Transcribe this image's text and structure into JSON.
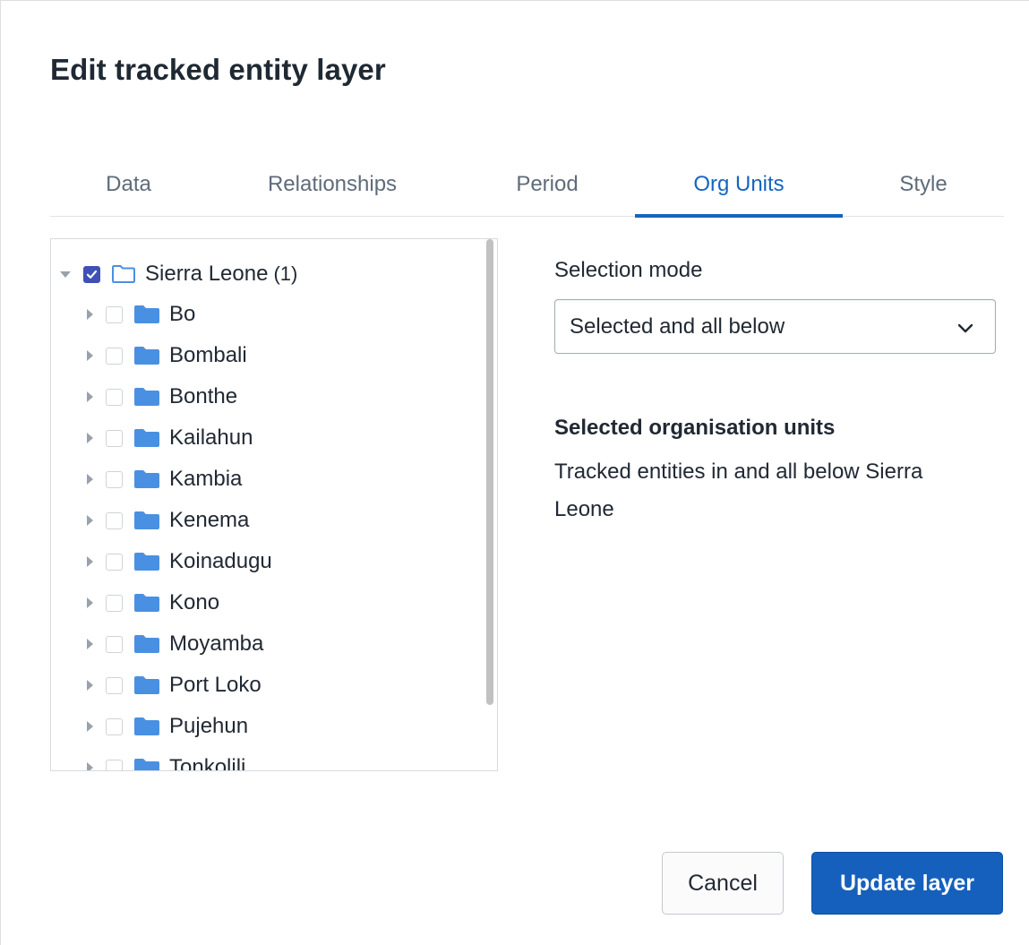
{
  "dialog": {
    "title": "Edit tracked entity layer"
  },
  "tabs": [
    {
      "label": "Data",
      "active": false
    },
    {
      "label": "Relationships",
      "active": false
    },
    {
      "label": "Period",
      "active": false
    },
    {
      "label": "Org Units",
      "active": true
    },
    {
      "label": "Style",
      "active": false
    }
  ],
  "colors": {
    "accent": "#1565c0",
    "folder": "#4a90e2",
    "checkbox_checked": "#3f51b5",
    "primary_button": "#1560bd"
  },
  "tree": {
    "root": {
      "label": "Sierra Leone",
      "count": "(1)",
      "checked": true,
      "expanded": true,
      "icon": "folder-outline-icon"
    },
    "children": [
      {
        "label": "Bo",
        "checked": false
      },
      {
        "label": "Bombali",
        "checked": false
      },
      {
        "label": "Bonthe",
        "checked": false
      },
      {
        "label": "Kailahun",
        "checked": false
      },
      {
        "label": "Kambia",
        "checked": false
      },
      {
        "label": "Kenema",
        "checked": false
      },
      {
        "label": "Koinadugu",
        "checked": false
      },
      {
        "label": "Kono",
        "checked": false
      },
      {
        "label": "Moyamba",
        "checked": false
      },
      {
        "label": "Port Loko",
        "checked": false
      },
      {
        "label": "Pujehun",
        "checked": false
      },
      {
        "label": "Tonkolili",
        "checked": false
      }
    ]
  },
  "selection": {
    "mode_label": "Selection mode",
    "mode_value": "Selected and all below",
    "heading": "Selected organisation units",
    "description": "Tracked entities in and all below Sierra Leone"
  },
  "buttons": {
    "cancel": "Cancel",
    "update": "Update layer"
  }
}
